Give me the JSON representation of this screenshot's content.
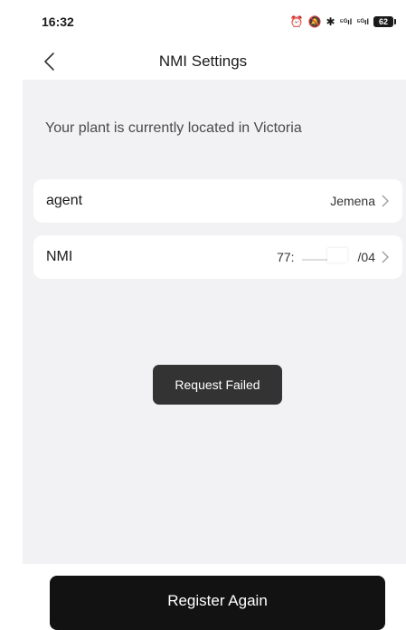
{
  "status_bar": {
    "time": "16:32",
    "icons": [
      "alarm-icon",
      "mute-icon",
      "bluetooth-icon",
      "signal-5g-icon",
      "signal-5g-icon",
      "battery-icon"
    ],
    "signal1": "⁵ᴳıl",
    "signal2": "⁵ᴳıl",
    "battery": "62"
  },
  "header": {
    "title": "NMI Settings"
  },
  "location": {
    "text": "Your plant is currently located in Victoria"
  },
  "rows": [
    {
      "label": "agent",
      "value": "Jemena"
    },
    {
      "label": "NMI",
      "value_prefix": "77:",
      "value_suffix": "/04"
    }
  ],
  "toast": {
    "text": "Request Failed"
  },
  "footer": {
    "button_label": "Register Again"
  },
  "colors": {
    "background": "#f2f2f4",
    "card": "#ffffff",
    "toast": "#333333",
    "button": "#121212"
  }
}
